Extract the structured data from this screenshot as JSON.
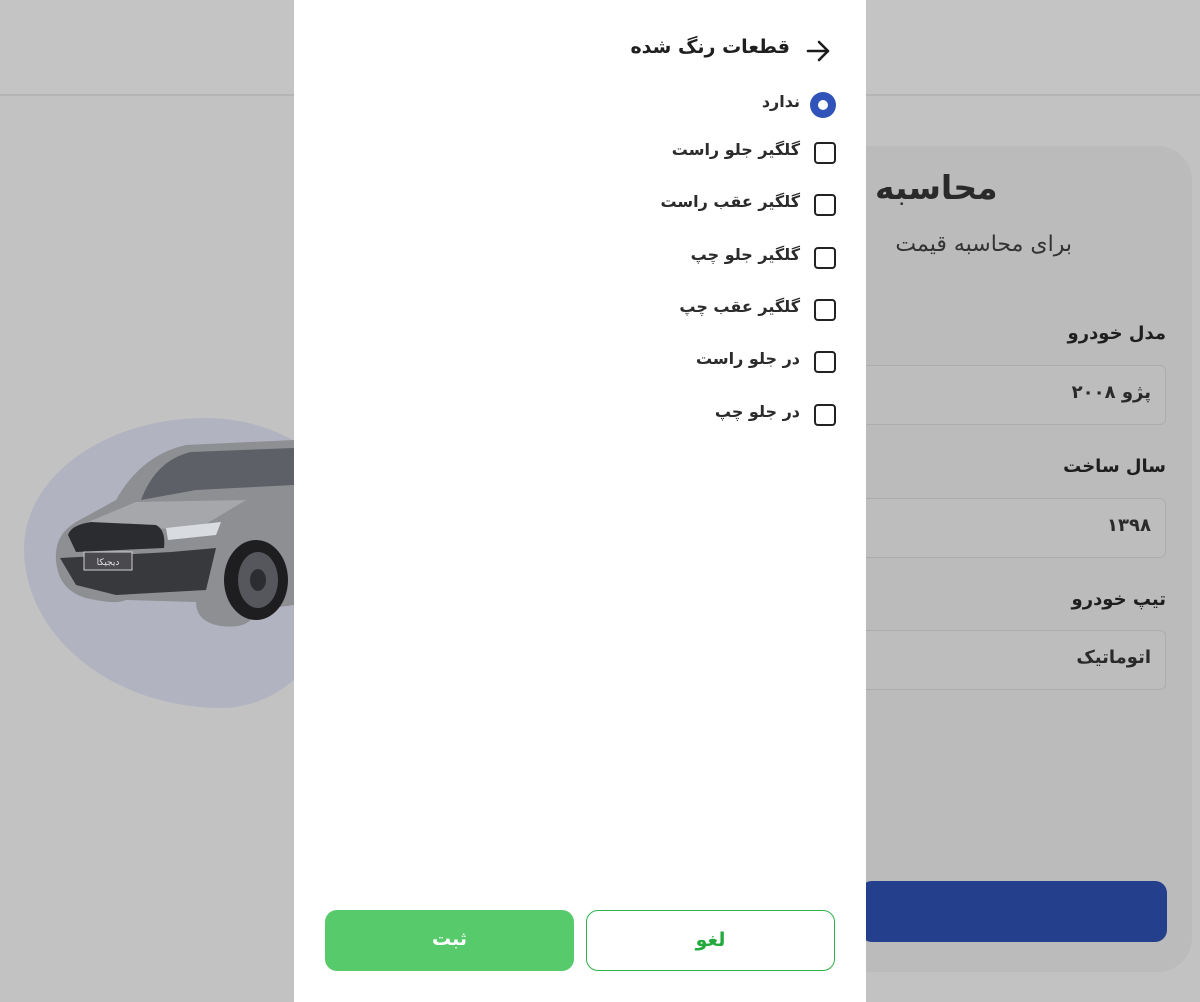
{
  "background": {
    "calculator": {
      "title": "محاسبه",
      "subtitle": "برای محاسبه قیمت",
      "fields": [
        {
          "label": "مدل خودرو",
          "value": "پژو ۲۰۰۸"
        },
        {
          "label": "سال ساخت",
          "value": "۱۳۹۸"
        },
        {
          "label": "تیپ خودرو",
          "value": "اتوماتیک"
        }
      ],
      "car_plate_text": "دیجیکا"
    }
  },
  "modal": {
    "title": "قطعات رنگ شده",
    "options": [
      {
        "label": "ندارد",
        "type": "radio",
        "selected": true
      },
      {
        "label": "گلگیر جلو راست",
        "type": "checkbox",
        "checked": false
      },
      {
        "label": "گلگیر عقب راست",
        "type": "checkbox",
        "checked": false
      },
      {
        "label": "گلگیر جلو چپ",
        "type": "checkbox",
        "checked": false
      },
      {
        "label": "گلگیر عقب چپ",
        "type": "checkbox",
        "checked": false
      },
      {
        "label": "در جلو راست",
        "type": "checkbox",
        "checked": false
      },
      {
        "label": "در جلو چپ",
        "type": "checkbox",
        "checked": false
      }
    ],
    "cancel_label": "لغو",
    "submit_label": "ثبت"
  },
  "colors": {
    "overlay_background": "#c2c2c2",
    "radio_selected": "#2f53b8",
    "submit_green": "#57cb6c",
    "cancel_green": "#23a93e",
    "calculate_button": "#24408c"
  }
}
